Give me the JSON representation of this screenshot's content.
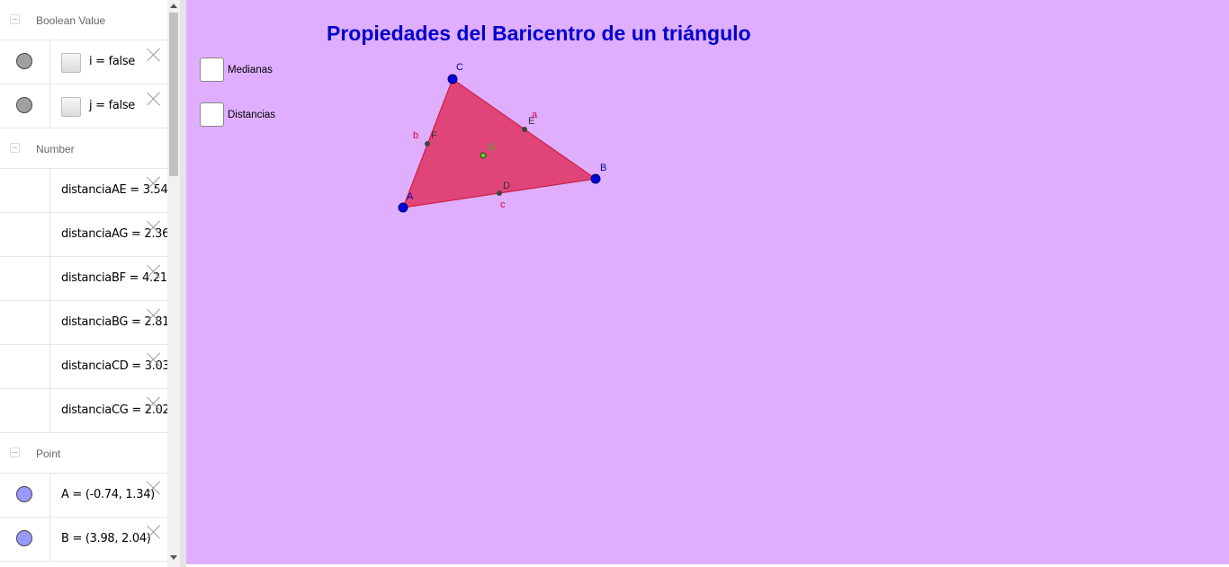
{
  "algebra": {
    "groups": [
      {
        "title": "Boolean Value"
      },
      {
        "title": "Number"
      },
      {
        "title": "Point"
      }
    ],
    "booleans": [
      {
        "expr": "i = false"
      },
      {
        "expr": "j = false"
      }
    ],
    "numbers": [
      {
        "expr": "distanciaAE = 3.54"
      },
      {
        "expr": "distanciaAG = 2.36"
      },
      {
        "expr": "distanciaBF = 4.21"
      },
      {
        "expr": "distanciaBG = 2.81"
      },
      {
        "expr": "distanciaCD = 3.03"
      },
      {
        "expr": "distanciaCG = 2.02"
      }
    ],
    "points": [
      {
        "expr": "A = (-0.74, 1.34)"
      },
      {
        "expr": "B = (3.98, 2.04)"
      }
    ]
  },
  "graphics": {
    "title": "Propiedades del Baricentro de un triángulo",
    "checkboxes": [
      {
        "label": "Medianas"
      },
      {
        "label": "Distancias"
      }
    ],
    "colors": {
      "background": "#dfaeff",
      "triangle_fill": "#e0457a",
      "triangle_stroke": "#cc2244",
      "vertex": "#0000dd",
      "vertex_label": "#0000aa",
      "midpoint": "#444444",
      "centroid": "#66cc33",
      "side_label": "#dd0044",
      "title": "#0000cc"
    },
    "labels": {
      "A": "A",
      "B": "B",
      "C": "C",
      "D": "D",
      "E": "E",
      "F": "F",
      "G": "G",
      "a": "a",
      "b": "b",
      "c": "c"
    }
  }
}
